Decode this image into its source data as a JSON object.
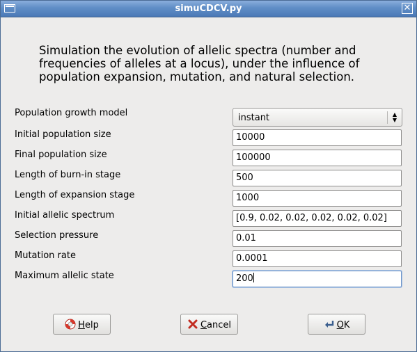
{
  "window": {
    "title": "simuCDCV.py"
  },
  "description": "Simulation the evolution of allelic spectra (number and frequencies of alleles at a locus), under the influence of population expansion, mutation, and natural selection.",
  "form": {
    "growth_model": {
      "label": "Population growth model",
      "value": "instant"
    },
    "fields": [
      {
        "label": "Initial population size",
        "value": "10000"
      },
      {
        "label": "Final population size",
        "value": "100000"
      },
      {
        "label": "Length of burn-in stage",
        "value": "500"
      },
      {
        "label": "Length of expansion stage",
        "value": "1000"
      },
      {
        "label": "Initial allelic spectrum",
        "value": "[0.9, 0.02, 0.02, 0.02, 0.02, 0.02]"
      },
      {
        "label": "Selection pressure",
        "value": "0.01"
      },
      {
        "label": "Mutation rate",
        "value": "0.0001"
      },
      {
        "label": "Maximum allelic state",
        "value": "200"
      }
    ]
  },
  "buttons": {
    "help": {
      "label_mnemonic": "H",
      "label_rest": "elp",
      "icon": "lifebuoy-icon"
    },
    "cancel": {
      "label_mnemonic": "C",
      "label_rest": "ancel",
      "icon": "red-x-icon"
    },
    "ok": {
      "label_mnemonic": "O",
      "label_rest": "K",
      "icon": "return-arrow-icon"
    }
  },
  "colors": {
    "titlebar": "#5f8dc6",
    "window_bg": "#edeceb",
    "focus": "#6f95c9"
  }
}
